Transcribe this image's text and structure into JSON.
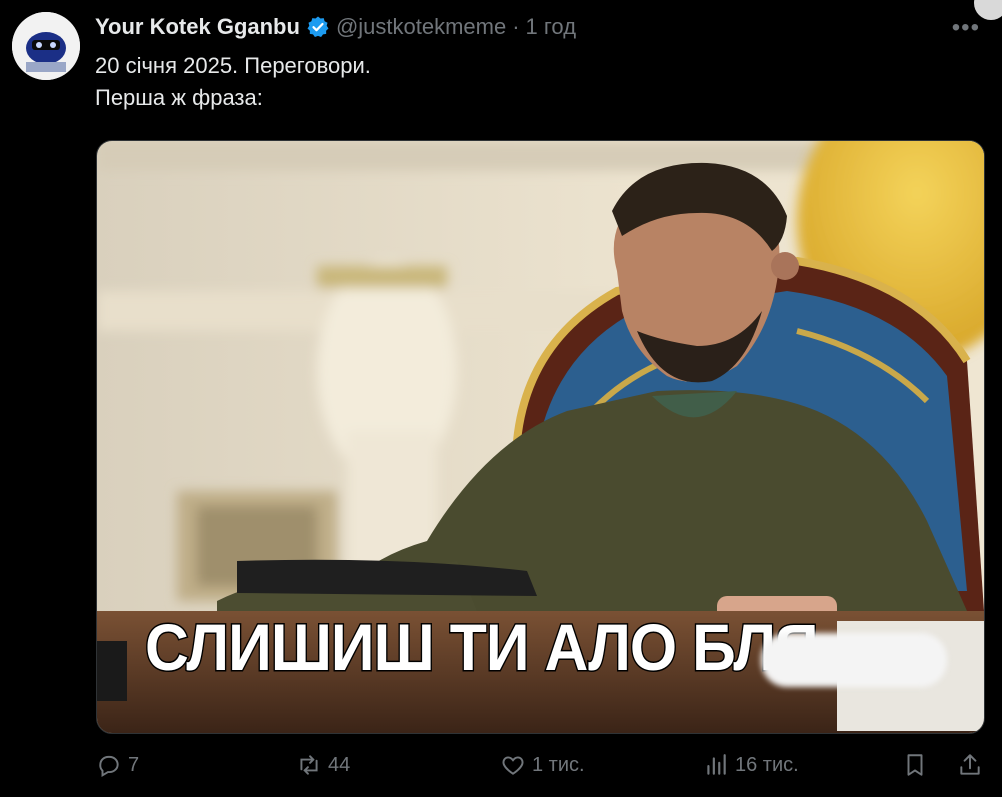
{
  "tweet": {
    "author_name": "Your Kotek Gganbu",
    "handle": "@justkotekmeme",
    "separator": "·",
    "time": "1 год",
    "text_line1": "20 січня 2025. Переговори.",
    "text_line2": "Перша ж фраза:",
    "more_icon": "more-icon",
    "verified_color": "#1d9bf0"
  },
  "media": {
    "caption": "СЛИШИШ ТИ АЛО БЛЯ"
  },
  "actions": {
    "replies": "7",
    "reposts": "44",
    "likes": "1 тис.",
    "views": "16 тис.",
    "icons": [
      "reply-icon",
      "repost-icon",
      "like-icon",
      "views-icon",
      "bookmark-icon",
      "share-icon"
    ]
  }
}
